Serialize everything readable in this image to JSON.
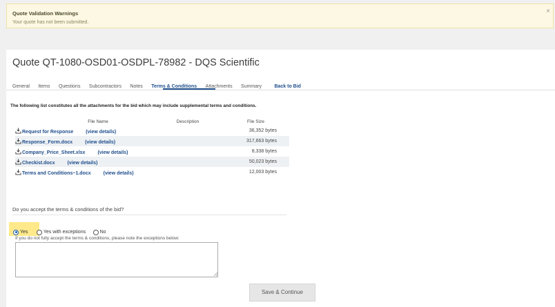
{
  "warning": {
    "title": "Quote Validation Warnings",
    "message": "Your quote has not been submitted.",
    "close": "×"
  },
  "quote": {
    "title": "Quote QT-1080-OSD01-OSDPL-78982 - DQS Scientific"
  },
  "tabs": [
    {
      "label": "General"
    },
    {
      "label": "Items"
    },
    {
      "label": "Questions"
    },
    {
      "label": "Subcontractors"
    },
    {
      "label": "Notes"
    },
    {
      "label": "Terms & Conditions",
      "active": true
    },
    {
      "label": "Attachments"
    },
    {
      "label": "Summary"
    },
    {
      "label": "Back to Bid"
    }
  ],
  "attachments": {
    "intro": "The following list constitutes all the attachments for the bid which may include supplemental terms and conditions.",
    "columns": {
      "file_name": "File Name",
      "description": "Description",
      "file_size": "File Size"
    },
    "rows": [
      {
        "name": "Request for Response",
        "details": "(view details)",
        "description": "",
        "size": "36,352 bytes"
      },
      {
        "name": "Response_Form.docx",
        "details": "(view details)",
        "description": "",
        "size": "317,663 bytes"
      },
      {
        "name": "Company_Price_Sheet.xlsx",
        "details": "(view details)",
        "description": "",
        "size": "8,338 bytes"
      },
      {
        "name": "Checkist.docx",
        "details": "(view details)",
        "description": "",
        "size": "50,023 bytes"
      },
      {
        "name": "Terms and Conditions~1.docx",
        "details": "(view details)",
        "description": "",
        "size": "12,003 bytes"
      }
    ]
  },
  "terms": {
    "question": "Do you accept the terms & conditions of the bid?",
    "options": [
      {
        "label": "Yes",
        "checked": true
      },
      {
        "label": "Yes with exceptions",
        "checked": false
      },
      {
        "label": "No",
        "checked": false
      }
    ],
    "exceptions_label": "If you do not fully accept the terms & conditions, please note the exceptions below:",
    "exceptions_value": ""
  },
  "actions": {
    "save_continue": "Save & Continue"
  },
  "colors": {
    "link": "#1f4e8c",
    "warning_bg": "#fcf8e3",
    "highlight": "#ffe98a"
  },
  "icons": {
    "attachment": "download-icon"
  }
}
